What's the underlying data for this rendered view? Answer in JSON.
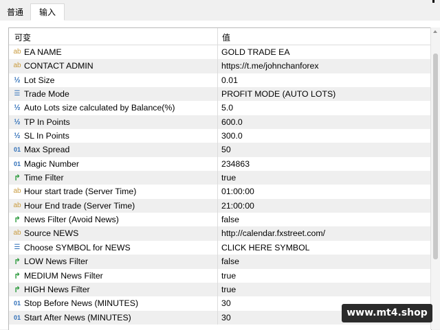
{
  "tabs": [
    {
      "label": "普通",
      "active": false
    },
    {
      "label": "输入",
      "active": true
    }
  ],
  "grid": {
    "col_variable": "可变",
    "col_value": "值"
  },
  "rows": [
    {
      "icon": "ab",
      "name": "EA NAME",
      "value": " GOLD TRADE EA"
    },
    {
      "icon": "ab",
      "name": "CONTACT ADMIN",
      "value": "https://t.me/johnchanforex"
    },
    {
      "icon": "half",
      "name": "Lot Size",
      "value": "0.01"
    },
    {
      "icon": "list",
      "name": "Trade Mode",
      "value": "PROFIT MODE (AUTO LOTS)"
    },
    {
      "icon": "half",
      "name": "Auto Lots size calculated by Balance(%)",
      "value": "5.0"
    },
    {
      "icon": "half",
      "name": "TP In Points",
      "value": "600.0"
    },
    {
      "icon": "half",
      "name": "SL In Points",
      "value": "300.0"
    },
    {
      "icon": "num",
      "name": "Max Spread",
      "value": "50"
    },
    {
      "icon": "num",
      "name": "Magic Number",
      "value": "234863"
    },
    {
      "icon": "bool",
      "name": "Time Filter",
      "value": "true"
    },
    {
      "icon": "ab",
      "name": "Hour start trade (Server Time)",
      "value": "01:00:00"
    },
    {
      "icon": "ab",
      "name": "Hour End trade (Server Time)",
      "value": "21:00:00"
    },
    {
      "icon": "bool",
      "name": "News Filter (Avoid News)",
      "value": "false"
    },
    {
      "icon": "ab",
      "name": "Source NEWS",
      "value": "http://calendar.fxstreet.com/"
    },
    {
      "icon": "list",
      "name": "Choose SYMBOL for NEWS",
      "value": "CLICK HERE SYMBOL"
    },
    {
      "icon": "bool",
      "name": "LOW News Filter",
      "value": "false"
    },
    {
      "icon": "bool",
      "name": "MEDIUM News Filter",
      "value": "true"
    },
    {
      "icon": "bool",
      "name": "HIGH News Filter",
      "value": "true"
    },
    {
      "icon": "num",
      "name": "Stop Before News (MINUTES)",
      "value": "30"
    },
    {
      "icon": "num",
      "name": "Start After News (MINUTES)",
      "value": "30"
    }
  ],
  "icon_glyphs": {
    "ab": "ab",
    "half": "½",
    "num": "01",
    "list": "☰",
    "bool": "↱"
  },
  "watermark": "www.mt4.shop"
}
